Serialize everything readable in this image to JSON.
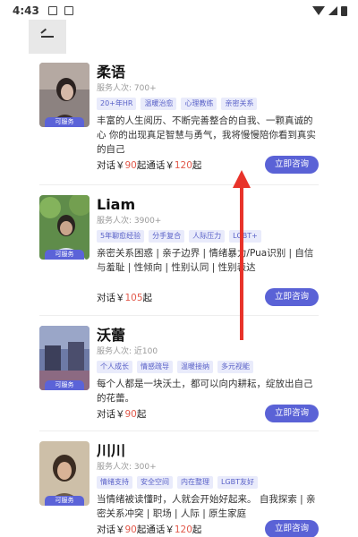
{
  "status": {
    "time": "4:43"
  },
  "colors": {
    "accent": "#5a62d6",
    "price": "#e25a4c",
    "tag_bg": "#e9ebfb"
  },
  "icons": {
    "back": "back-arrow-icon",
    "wifi": "wifi-icon",
    "signal": "signal-icon",
    "battery": "battery-icon"
  },
  "counselors": [
    {
      "name": "柔语",
      "served": "服务人次:  700+",
      "avatar_label": "可服务",
      "tags": [
        "20+年HR",
        "温暖治愈",
        "心理教练",
        "亲密关系"
      ],
      "desc": "丰富的人生阅历、不断完善整合的自我、一颗真诚的心 你的出现真足智慧与勇气，我将慢慢陪你看到真实的自己",
      "price_prefix": "对话￥",
      "chat_price": "90",
      "mid": "起通话￥",
      "call_price": "120",
      "suffix": "起",
      "button": "立即咨询"
    },
    {
      "name": "Liam",
      "served": "服务人次:  3900+",
      "avatar_label": "可服务",
      "tags": [
        "5年聊愈经验",
        "分手复合",
        "人际压力",
        "LGBT+"
      ],
      "desc": "亲密关系困惑 | 亲子边界 | 情绪暴力/Pua识别 | 自信与羞耻 | 性倾向 | 性别认同 | 性别表达",
      "price_prefix": "对话￥",
      "chat_price": "105",
      "mid": "",
      "call_price": "",
      "suffix": "起",
      "button": "立即咨询"
    },
    {
      "name": "沃蕾",
      "served": "服务人次:  近100",
      "avatar_label": "可服务",
      "tags": [
        "个人成长",
        "情感疏导",
        "温暖接纳",
        "多元视能"
      ],
      "desc": "每个人都是一块沃土，都可以向内耕耘，绽放出自己的花蕾。",
      "price_prefix": "对话￥",
      "chat_price": "90",
      "mid": "",
      "call_price": "",
      "suffix": "起",
      "button": "立即咨询"
    },
    {
      "name": "川川",
      "served": "服务人次:  300+",
      "avatar_label": "可服务",
      "tags": [
        "情绪支持",
        "安全空间",
        "内在整理",
        "LGBT友好"
      ],
      "desc": "当情绪被读懂时，人就会开始好起来。 自我探索 | 亲密关系冲突 | 职场 | 人际 | 原生家庭",
      "price_prefix": "对话￥",
      "chat_price": "90",
      "mid": "起通话￥",
      "call_price": "120",
      "suffix": "起",
      "button": "立即咨询"
    }
  ]
}
